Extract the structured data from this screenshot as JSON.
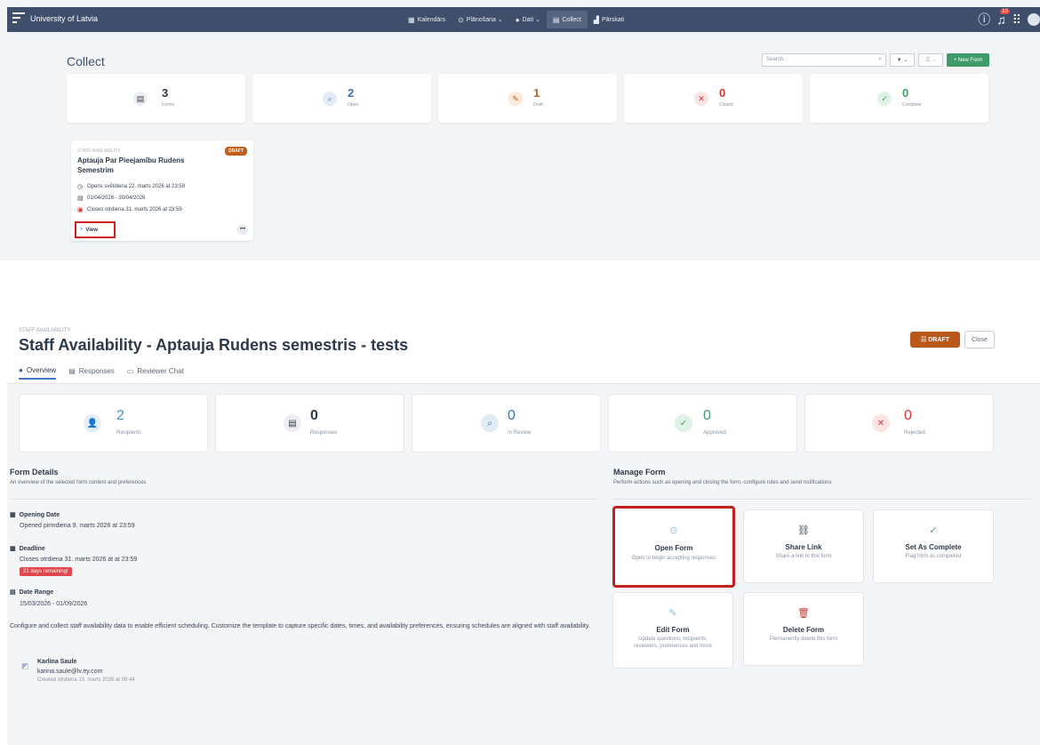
{
  "top": {
    "navbar": {
      "brand": "University of Latvia",
      "menu": [
        {
          "icon": "▦",
          "label": "Kalendārs"
        },
        {
          "icon": "⊙",
          "label": "Plānošana ⌄"
        },
        {
          "icon": "●",
          "label": "Dati ⌄"
        },
        {
          "icon": "▤",
          "label": "Collect"
        },
        {
          "icon": "▟",
          "label": "Pārskati"
        }
      ],
      "notification_count": "10"
    },
    "page_title": "Collect",
    "search_placeholder": "Search...",
    "filter_label": "▼ ⌄",
    "view_label": "☰ ⌄",
    "new_form_label": "+ New Form",
    "stats": [
      {
        "icon": "▤",
        "value": "3",
        "label": "Forms"
      },
      {
        "icon": "⌕",
        "value": "2",
        "label": "Open"
      },
      {
        "icon": "✎",
        "value": "1",
        "label": "Draft"
      },
      {
        "icon": "✕",
        "value": "0",
        "label": "Closed"
      },
      {
        "icon": "✓",
        "value": "0",
        "label": "Complete"
      }
    ],
    "form_card": {
      "category": "STAFF AVAILABILITY",
      "status": "DRAFT",
      "title": "Aptauja Par Pieejamību Rudens Semestrim",
      "opens": "Opens svētdiena 22. marts 2026 at 23:59",
      "date_range": "01/04/2026 - 30/04/2026",
      "closes": "Closes otrdiena 31. marts 2026 at 23:59",
      "view_label": "View",
      "more_label": "•••"
    }
  },
  "detail": {
    "category": "STAFF AVAILABILITY",
    "title": "Staff Availability - Aptauja Rudens semestris - tests",
    "draft_label": "☷ DRAFT",
    "close_label": "Close",
    "tabs": [
      {
        "icon": "●",
        "label": "Overview"
      },
      {
        "icon": "▤",
        "label": "Responses"
      },
      {
        "icon": "▭",
        "label": "Reviewer Chat"
      }
    ],
    "stats": [
      {
        "icon": "👤",
        "value": "2",
        "label": "Recipients"
      },
      {
        "icon": "▤",
        "value": "0",
        "label": "Responses"
      },
      {
        "icon": "⌕",
        "value": "0",
        "label": "In Review"
      },
      {
        "icon": "✓",
        "value": "0",
        "label": "Approved"
      },
      {
        "icon": "✕",
        "value": "0",
        "label": "Rejected"
      }
    ],
    "form_details": {
      "title": "Form Details",
      "subtitle": "An overview of the selected form content and preferences",
      "opening_label": "Opening Date",
      "opening_value": "Opened pirmdiena 9. marts 2026 at 23:59",
      "deadline_label": "Deadline",
      "deadline_value": "Closes otrdiena 31. marts 2026 at at 23:59",
      "remaining": "21 days remaining!",
      "range_label": "Date Range",
      "range_value": "15/03/2026 - 01/09/2026",
      "description": "Configure and collect staff availability data to enable efficient scheduling. Customize the template to capture specific dates, times, and availability preferences, ensuring schedules are aligned with staff availability.",
      "author_name": "Karlina Saule",
      "author_email": "karina.saule@lv.ey.com",
      "author_created": "Created otrdiena 10. marts 2026 at 09:44"
    },
    "manage": {
      "title": "Manage Form",
      "subtitle": "Perform actions such as opening and closing the form, configure rules and send notifications",
      "actions": [
        {
          "icon": "⊙",
          "title": "Open Form",
          "desc": "Open to begin accepting responses"
        },
        {
          "icon": "⛓",
          "title": "Share Link",
          "desc": "Share a link to this form"
        },
        {
          "icon": "✓",
          "title": "Set As Complete",
          "desc": "Flag form as completed"
        },
        {
          "icon": "✎",
          "title": "Edit Form",
          "desc": "Update questions, recipients, reviewers, preferences and more"
        },
        {
          "icon": "🗑",
          "title": "Delete Form",
          "desc": "Permanently delete this form"
        }
      ]
    }
  }
}
